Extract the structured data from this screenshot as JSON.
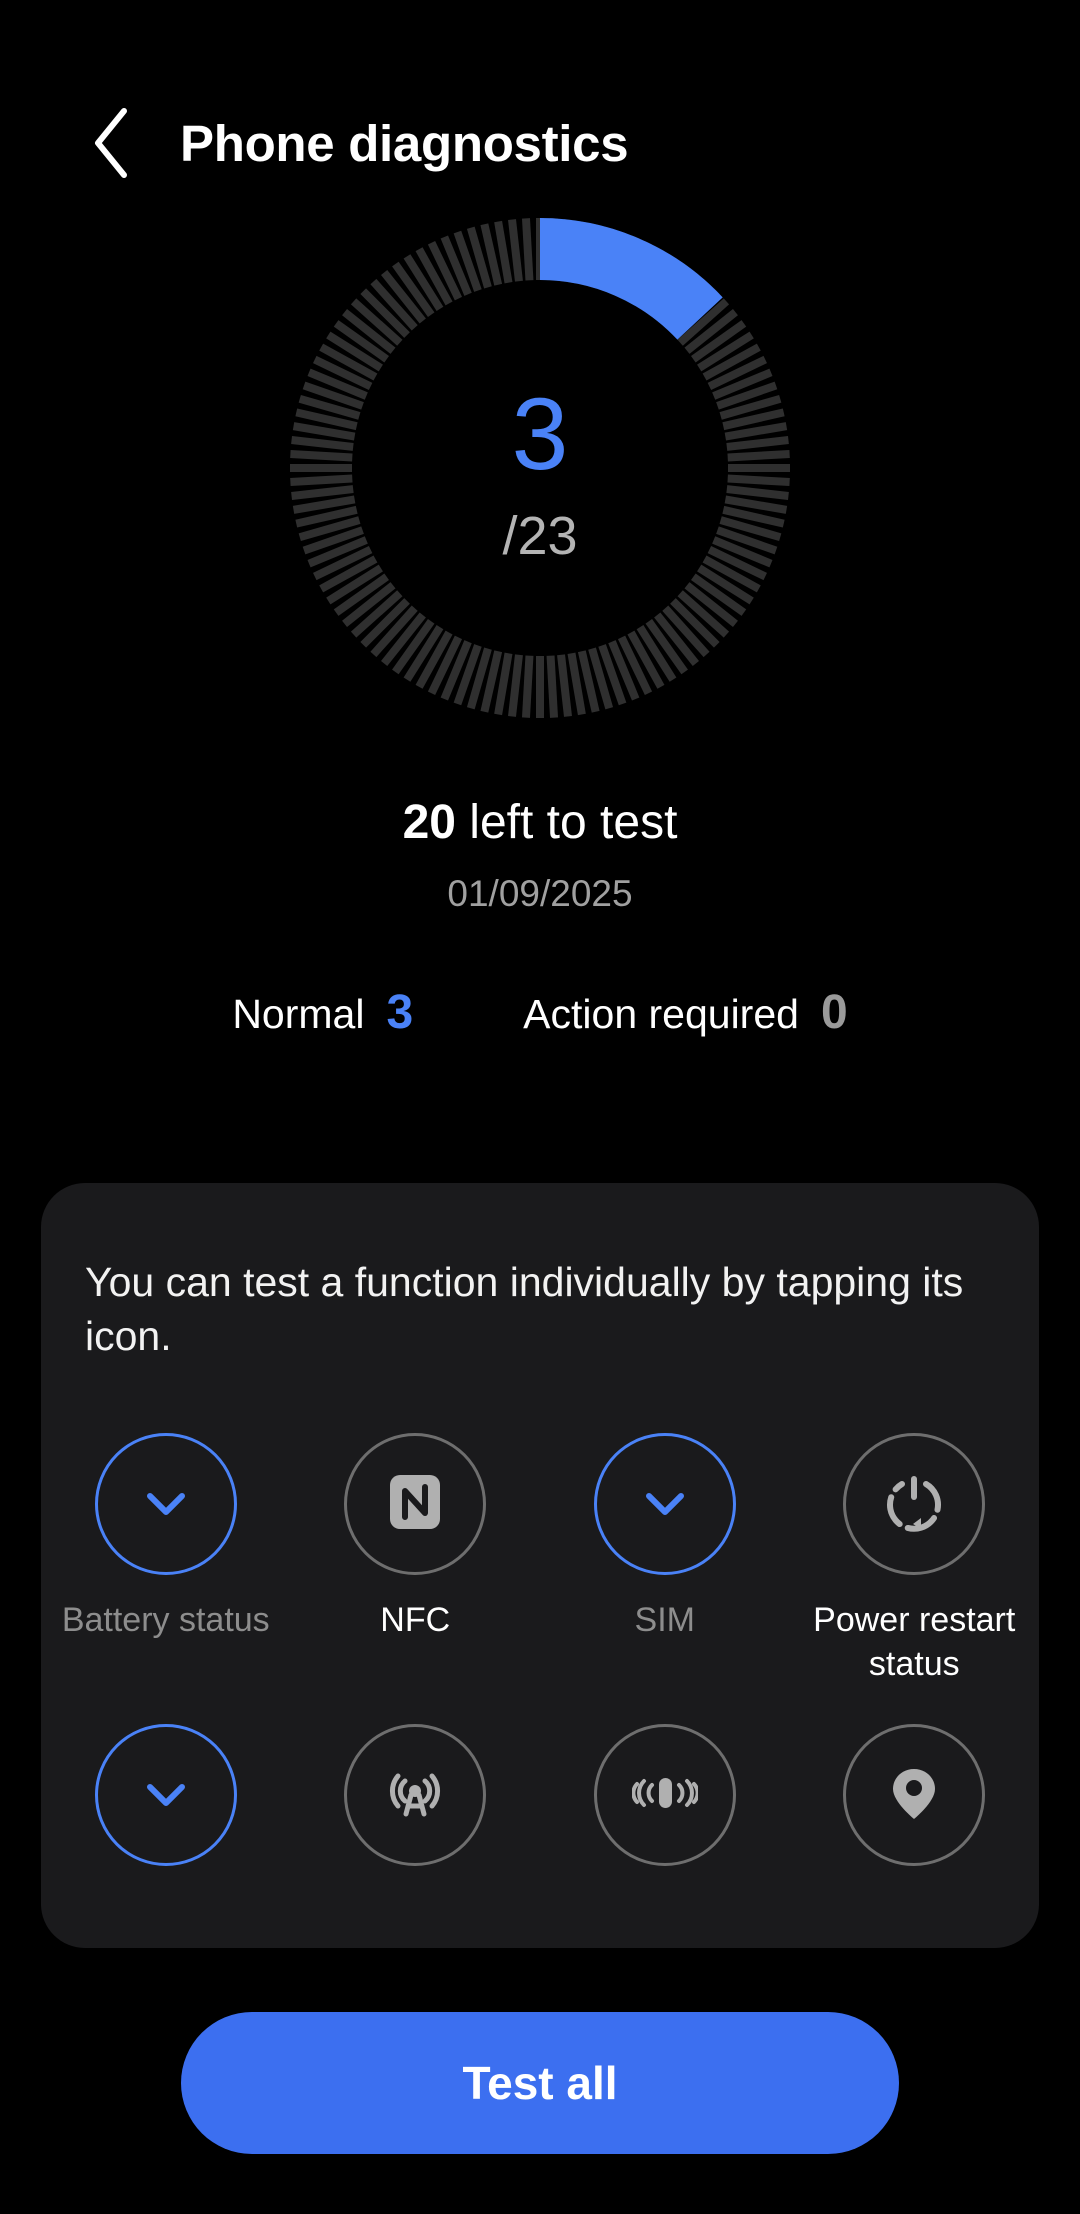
{
  "header": {
    "back_icon": "chevron-left-icon",
    "title": "Phone diagnostics"
  },
  "gauge": {
    "tested": "3",
    "total_label": "/23",
    "total": 23,
    "progress_color": "#4a82f7",
    "track_color": "#2b2b2b"
  },
  "summary": {
    "remaining_count": "20",
    "remaining_text": " left to test",
    "date": "01/09/2025"
  },
  "stats": [
    {
      "label": "Normal",
      "value": "3",
      "tone": "blue"
    },
    {
      "label": "Action required",
      "value": "0",
      "tone": "grey"
    }
  ],
  "card": {
    "description": "You can test a function individually by tapping its icon.",
    "items": [
      {
        "label": "Battery status",
        "icon": "check-icon",
        "tested": true
      },
      {
        "label": "NFC",
        "icon": "nfc-icon",
        "tested": false
      },
      {
        "label": "SIM",
        "icon": "check-icon",
        "tested": true
      },
      {
        "label": "Power restart status",
        "icon": "power-restart-icon",
        "tested": false
      },
      {
        "label": "",
        "icon": "check-icon",
        "tested": true
      },
      {
        "label": "",
        "icon": "broadcast-tower-icon",
        "tested": false
      },
      {
        "label": "",
        "icon": "vibration-icon",
        "tested": false
      },
      {
        "label": "",
        "icon": "location-pin-icon",
        "tested": false
      }
    ]
  },
  "footer": {
    "test_all_label": "Test all",
    "button_color": "#3c6ff0"
  }
}
